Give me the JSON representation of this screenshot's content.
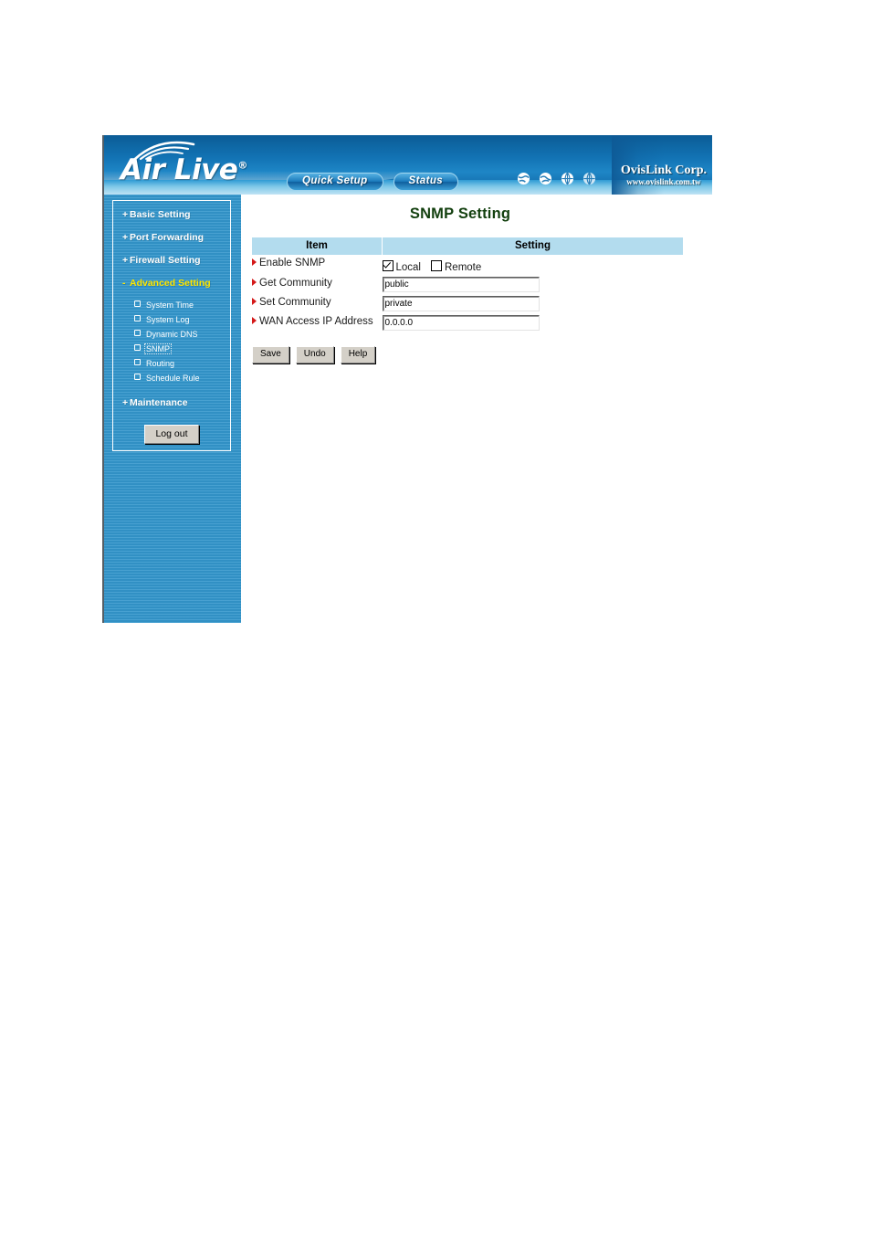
{
  "header": {
    "brand": "Air Live",
    "brand_reg": "®",
    "nav": [
      {
        "label": "Quick Setup",
        "name": "quick-setup-button"
      },
      {
        "label": "Status",
        "name": "status-button"
      }
    ],
    "globes": [
      "globe-icon-1",
      "globe-icon-2",
      "globe-icon-3",
      "globe-icon-4"
    ],
    "corp_name": "OvisLink Corp.",
    "corp_url": "www.ovislink.com.tw"
  },
  "sidebar": {
    "groups": [
      {
        "sign": "+",
        "label": "Basic Setting",
        "active": false
      },
      {
        "sign": "+",
        "label": "Port Forwarding",
        "active": false
      },
      {
        "sign": "+",
        "label": "Firewall Setting",
        "active": false
      },
      {
        "sign": "-",
        "label": "Advanced Setting",
        "active": true
      }
    ],
    "sub_items": [
      {
        "label": "System Time",
        "focused": false
      },
      {
        "label": "System Log",
        "focused": false
      },
      {
        "label": "Dynamic DNS",
        "focused": false
      },
      {
        "label": "SNMP",
        "focused": true
      },
      {
        "label": "Routing",
        "focused": false
      },
      {
        "label": "Schedule Rule",
        "focused": false
      }
    ],
    "maintenance": {
      "sign": "+",
      "label": "Maintenance"
    },
    "logout_label": "Log out",
    "colors": {
      "background": "#3396cc",
      "active_text": "#ffe800",
      "text": "#ffffff"
    }
  },
  "main": {
    "title": "SNMP Setting",
    "title_color": "#13400f",
    "table": {
      "headers": [
        "Item",
        "Setting"
      ],
      "header_bg": "#b3dcee",
      "rows": [
        {
          "item": "Enable SNMP",
          "type": "checkboxes",
          "checkboxes": [
            {
              "label": "Local",
              "checked": true
            },
            {
              "label": "Remote",
              "checked": false
            }
          ]
        },
        {
          "item": "Get Community",
          "type": "text",
          "value": "public"
        },
        {
          "item": "Set Community",
          "type": "text",
          "value": "private"
        },
        {
          "item": "WAN Access IP Address",
          "type": "text",
          "value": "0.0.0.0"
        }
      ]
    },
    "buttons": [
      {
        "label": "Save",
        "name": "save-button"
      },
      {
        "label": "Undo",
        "name": "undo-button"
      },
      {
        "label": "Help",
        "name": "help-button"
      }
    ]
  }
}
